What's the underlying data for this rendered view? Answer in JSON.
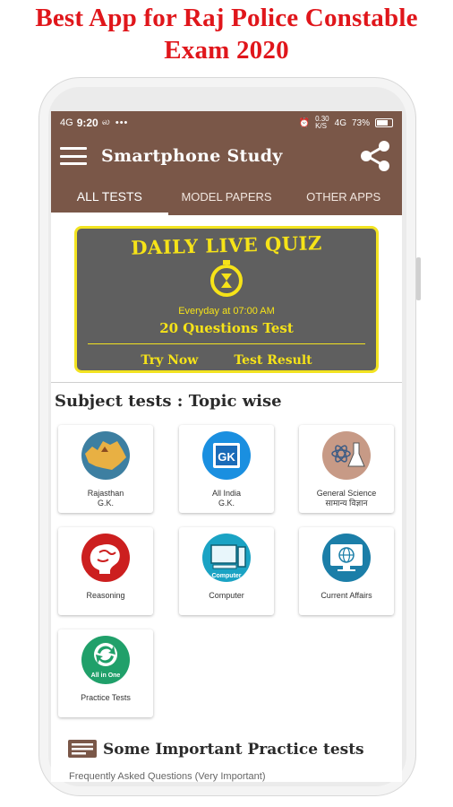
{
  "headline": {
    "line1": "Best App for Raj Police Constable",
    "line2": "Exam 2020"
  },
  "status_bar": {
    "left_icons": "4G",
    "time": "9:20",
    "suffix": "ல",
    "dots": "•••",
    "net_speed": "0.30\nK/S",
    "signal": "4G",
    "battery": "73%"
  },
  "app_bar": {
    "title": "Smartphone Study",
    "menu_icon": "hamburger-icon",
    "share_icon": "share-icon"
  },
  "tabs": [
    {
      "label": "ALL TESTS",
      "active": true
    },
    {
      "label": "MODEL PAPERS",
      "active": false
    },
    {
      "label": "OTHER APPS",
      "active": false
    }
  ],
  "quiz": {
    "title": "DAILY LIVE QUIZ",
    "schedule": "Everyday at 07:00 AM",
    "questions": "20 Questions Test",
    "try_now": "Try Now",
    "test_result": "Test Result"
  },
  "subject_section": {
    "title": "Subject tests : Topic wise",
    "cards": [
      {
        "line1": "Rajasthan",
        "line2": "G.K.",
        "icon": "rajasthan-map-icon"
      },
      {
        "line1": "All India",
        "line2": "G.K.",
        "icon": "gk-book-icon",
        "badge": "GK"
      },
      {
        "line1": "General Science",
        "line2": "सामान्य विज्ञान",
        "icon": "science-flask-icon"
      },
      {
        "line1": "Reasoning",
        "line2": "",
        "icon": "brain-icon"
      },
      {
        "line1": "Computer",
        "line2": "",
        "icon": "computer-icon",
        "badge": "Computer"
      },
      {
        "line1": "Current Affairs",
        "line2": "",
        "icon": "monitor-globe-icon"
      },
      {
        "line1": "Practice Tests",
        "line2": "",
        "icon": "practice-refresh-icon",
        "badge": "All in One"
      }
    ]
  },
  "important_section": {
    "title": "Some Important Practice tests",
    "first_item": "Frequently Asked Questions (Very Important)"
  },
  "colors": {
    "brand": "#7a5748",
    "quiz_bg": "#5f5f5f",
    "quiz_accent": "#f6e318",
    "headline": "#e0161b"
  }
}
